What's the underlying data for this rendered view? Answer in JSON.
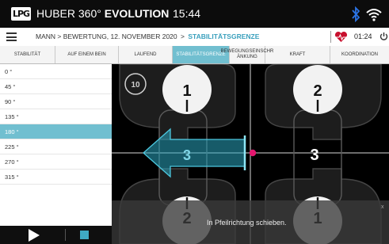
{
  "header": {
    "logo_text": "LPG",
    "brand_name": "HUBER 360°",
    "brand_suffix": "EVOLUTION",
    "time": "15:44"
  },
  "breadcrumb": {
    "menu_icon": "hamburger-icon",
    "path": "MANN > BEWERTUNG, 12. NOVEMBER 2020",
    "separator": ">",
    "current": "STABILITÄTSGRENZE",
    "timer": "01:24"
  },
  "tabs": [
    {
      "label": "STABILITÄT",
      "active": false
    },
    {
      "label": "AUF EINEM BEIN",
      "active": false
    },
    {
      "label": "LAUFEND",
      "active": false
    },
    {
      "label": "STABILITÄTSGRENZE",
      "active": true
    },
    {
      "label": "BEWEGUNGSEINSCHR ÄNKUNG",
      "active": false
    },
    {
      "label": "KRAFT",
      "active": false
    },
    {
      "label": "KOORDINATION",
      "active": false
    }
  ],
  "angles": [
    "0 °",
    "45 °",
    "90 °",
    "135 °",
    "180 °",
    "225 °",
    "270 °",
    "315 °"
  ],
  "selected_angle": "180 °",
  "viewer": {
    "badge": "10",
    "pads": {
      "top_left": "1",
      "top_right": "2",
      "bottom_left": "2",
      "bottom_right": "1"
    },
    "arrow_label": "3",
    "right_label": "3",
    "instruction": "In Pfeilrichtung schieben.",
    "close_label": "x"
  },
  "colors": {
    "accent": "#71bfd0",
    "arrow": "#2aa6bf",
    "center_dot": "#e5176f"
  }
}
